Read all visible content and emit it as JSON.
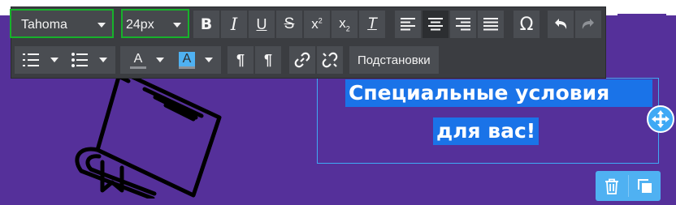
{
  "toolbar": {
    "font_family": "Tahoma",
    "font_size": "24px",
    "bold_icon": "bold-icon",
    "italic_icon": "italic-icon",
    "underline_icon": "underline-icon",
    "strike_icon": "strikethrough-icon",
    "superscript_icon": "superscript-icon",
    "subscript_icon": "subscript-icon",
    "clear_format_icon": "clear-format-icon",
    "align_icons": [
      "align-left-icon",
      "align-center-icon",
      "align-right-icon",
      "align-justify-icon"
    ],
    "special_char_glyph": "Ω",
    "undo_icon": "undo-icon",
    "redo_icon": "redo-icon",
    "row2": {
      "ordered_list_icon": "ordered-list-icon",
      "unordered_list_icon": "unordered-list-icon",
      "text_color_glyph": "A",
      "bg_color_glyph": "A",
      "ltr_icon": "ltr-paragraph-icon",
      "rtl_icon": "rtl-paragraph-icon",
      "link_icon": "link-icon",
      "unlink_icon": "unlink-icon",
      "substitutions_label": "Подстановки"
    },
    "colors": {
      "bar": "#3b3d41",
      "button": "#4a4d52",
      "highlight": "#17b22b"
    }
  },
  "content": {
    "line1": "Специальные условия",
    "line2": "для вас!",
    "colors": {
      "canvas": "#55309a",
      "selection": "#1a73e8",
      "frame": "#3fa9f5"
    }
  },
  "widgets": {
    "move_icon": "move-icon",
    "delete_icon": "trash-icon",
    "duplicate_icon": "duplicate-icon"
  }
}
